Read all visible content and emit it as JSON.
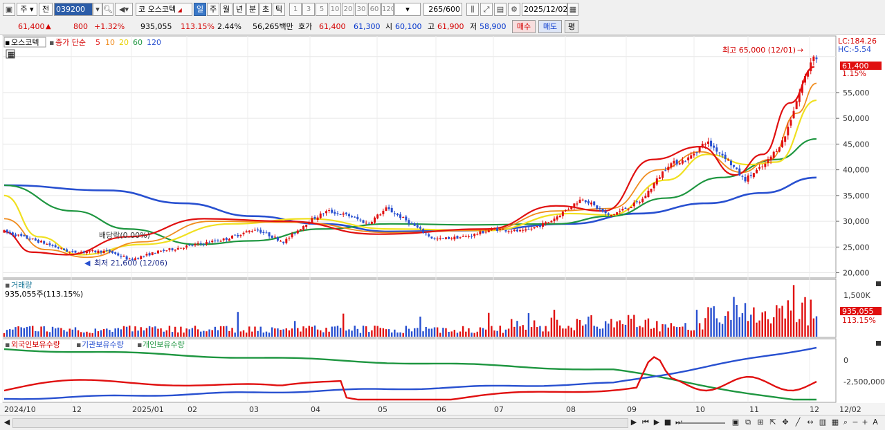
{
  "toolbar": {
    "market_type": "주",
    "prev_label": "전",
    "stock_code": "039200",
    "stock_prefix": "코",
    "stock_name": "오스코텍",
    "period_tabs": [
      "일",
      "주",
      "월",
      "년",
      "분",
      "초",
      "틱"
    ],
    "selected_period": "일",
    "intervals": [
      "1",
      "3",
      "5",
      "10",
      "20",
      "30",
      "60",
      "120"
    ],
    "count_display": "265/600",
    "date": "2025/12/02"
  },
  "quote": {
    "price": "61,400",
    "change": "800",
    "change_pct": "+1.32%",
    "volume": "935,055",
    "vol_ratio": "113.15%",
    "turnover": "2.44%",
    "amount": "56,265백만",
    "bid_label": "호가",
    "ask": "61,400",
    "bid": "61,300",
    "open_label": "시",
    "open": "60,100",
    "high_label": "고",
    "high": "61,900",
    "low_label": "저",
    "low": "58,900",
    "buy_label": "매수",
    "sell_label": "매도",
    "flat_label": "평"
  },
  "price_panel": {
    "stock_label": "오스코텍",
    "ma_title": "종가 단순",
    "ma_periods": [
      "5",
      "10",
      "20",
      "60",
      "120"
    ],
    "lc_label": "LC:184.26",
    "hc_label": "HC:-5.54",
    "last_price_tag": "61,400",
    "last_pct_tag": "1.15%",
    "high_annotation": "최고 65,000 (12/01)",
    "low_annotation": "최저 21,600 (12/06)",
    "dividend_annotation": "배당락(0.00%)",
    "y_ticks": [
      "55,000",
      "50,000",
      "45,000",
      "40,000",
      "35,000",
      "30,000",
      "25,000",
      "20,000"
    ]
  },
  "volume_panel": {
    "title": "거래량",
    "value_label": "935,055주(113.15%)",
    "y_tick": "1,500K",
    "last_tag": "935,055",
    "last_pct": "113.15%"
  },
  "holding_panel": {
    "legend": [
      "외국인보유수량",
      "기관보유수량",
      "개인보유수량"
    ],
    "y_ticks": [
      "0",
      "-2,500,000"
    ]
  },
  "x_axis": [
    "2024/10",
    "12",
    "2025/01",
    "02",
    "03",
    "04",
    "05",
    "06",
    "07",
    "08",
    "09",
    "10",
    "11",
    "12",
    "12/02"
  ],
  "colors": {
    "ma5": "#e01010",
    "ma10": "#f08c1e",
    "ma20": "#f0e020",
    "ma60": "#1e9640",
    "ma120": "#2850d0",
    "up": "#e01010",
    "down": "#2850d0",
    "foreign": "#e01010",
    "institution": "#2850d0",
    "individual": "#1e9640"
  },
  "chart_data": {
    "type": "candlestick",
    "price_close_trend": [
      [
        "2024-10-01",
        28000
      ],
      [
        "2024-10-20",
        26000
      ],
      [
        "2024-11-05",
        24000
      ],
      [
        "2024-11-25",
        24200
      ],
      [
        "2024-12-06",
        22500
      ],
      [
        "2024-12-20",
        24000
      ],
      [
        "2025-01-10",
        25500
      ],
      [
        "2025-01-25",
        26500
      ],
      [
        "2025-02-10",
        28500
      ],
      [
        "2025-02-25",
        26000
      ],
      [
        "2025-03-10",
        30000
      ],
      [
        "2025-03-20",
        32000
      ],
      [
        "2025-04-01",
        31000
      ],
      [
        "2025-04-10",
        29500
      ],
      [
        "2025-04-20",
        32500
      ],
      [
        "2025-05-01",
        30000
      ],
      [
        "2025-05-15",
        26500
      ],
      [
        "2025-06-01",
        27000
      ],
      [
        "2025-06-15",
        28500
      ],
      [
        "2025-07-01",
        28000
      ],
      [
        "2025-07-15",
        30000
      ],
      [
        "2025-08-01",
        34500
      ],
      [
        "2025-08-15",
        31000
      ],
      [
        "2025-09-01",
        34000
      ],
      [
        "2025-09-15",
        41000
      ],
      [
        "2025-09-25",
        42000
      ],
      [
        "2025-10-05",
        45500
      ],
      [
        "2025-10-15",
        42500
      ],
      [
        "2025-10-25",
        38000
      ],
      [
        "2025-11-05",
        41000
      ],
      [
        "2025-11-15",
        46000
      ],
      [
        "2025-11-22",
        54000
      ],
      [
        "2025-12-01",
        63000
      ],
      [
        "2025-12-02",
        61400
      ]
    ],
    "ma_series": [
      {
        "name": "5",
        "values": [
          [
            0,
            28000
          ],
          [
            40,
            24000
          ],
          [
            90,
            23500
          ],
          [
            180,
            27000
          ],
          [
            290,
            30500
          ],
          [
            410,
            30000
          ],
          [
            540,
            27500
          ],
          [
            700,
            28500
          ],
          [
            800,
            33000
          ],
          [
            870,
            32000
          ],
          [
            940,
            42000
          ],
          [
            1010,
            44500
          ],
          [
            1060,
            39000
          ],
          [
            1100,
            43000
          ],
          [
            1140,
            53000
          ],
          [
            1175,
            60000
          ]
        ]
      },
      {
        "name": "10",
        "values": [
          [
            0,
            30500
          ],
          [
            60,
            24500
          ],
          [
            120,
            23000
          ],
          [
            200,
            26000
          ],
          [
            300,
            30000
          ],
          [
            420,
            29800
          ],
          [
            560,
            27800
          ],
          [
            700,
            28300
          ],
          [
            800,
            32000
          ],
          [
            880,
            32500
          ],
          [
            950,
            40000
          ],
          [
            1010,
            43500
          ],
          [
            1070,
            39500
          ],
          [
            1110,
            42000
          ],
          [
            1150,
            51000
          ],
          [
            1178,
            56800
          ]
        ]
      },
      {
        "name": "20",
        "values": [
          [
            0,
            35000
          ],
          [
            50,
            27000
          ],
          [
            110,
            23500
          ],
          [
            200,
            25500
          ],
          [
            330,
            29500
          ],
          [
            440,
            30500
          ],
          [
            560,
            28500
          ],
          [
            700,
            28200
          ],
          [
            820,
            31500
          ],
          [
            880,
            31200
          ],
          [
            960,
            38000
          ],
          [
            1020,
            43000
          ],
          [
            1080,
            41000
          ],
          [
            1120,
            41500
          ],
          [
            1178,
            53500
          ]
        ]
      },
      {
        "name": "60",
        "values": [
          [
            0,
            37000
          ],
          [
            100,
            32000
          ],
          [
            180,
            28500
          ],
          [
            280,
            25500
          ],
          [
            360,
            26200
          ],
          [
            460,
            28500
          ],
          [
            560,
            29500
          ],
          [
            680,
            29300
          ],
          [
            800,
            29500
          ],
          [
            880,
            31000
          ],
          [
            960,
            34500
          ],
          [
            1040,
            38500
          ],
          [
            1120,
            42000
          ],
          [
            1178,
            46000
          ]
        ]
      },
      {
        "name": "120",
        "values": [
          [
            0,
            37000
          ],
          [
            150,
            36000
          ],
          [
            260,
            33500
          ],
          [
            360,
            31000
          ],
          [
            460,
            29500
          ],
          [
            560,
            28000
          ],
          [
            680,
            28200
          ],
          [
            820,
            29500
          ],
          [
            920,
            31500
          ],
          [
            1020,
            33500
          ],
          [
            1100,
            35500
          ],
          [
            1178,
            38500
          ]
        ]
      }
    ],
    "holdings": [
      {
        "name": "외국인보유수량",
        "trend": "volatile, peak near 2025/09 then declining"
      },
      {
        "name": "기관보유수량",
        "trend": "rising steadily, highest at 2025/12"
      },
      {
        "name": "개인보유수량",
        "trend": "falling steadily, lowest at 2025/12"
      }
    ],
    "price_ylim": [
      19000,
      66000
    ],
    "volume_ymax": 1800000
  }
}
